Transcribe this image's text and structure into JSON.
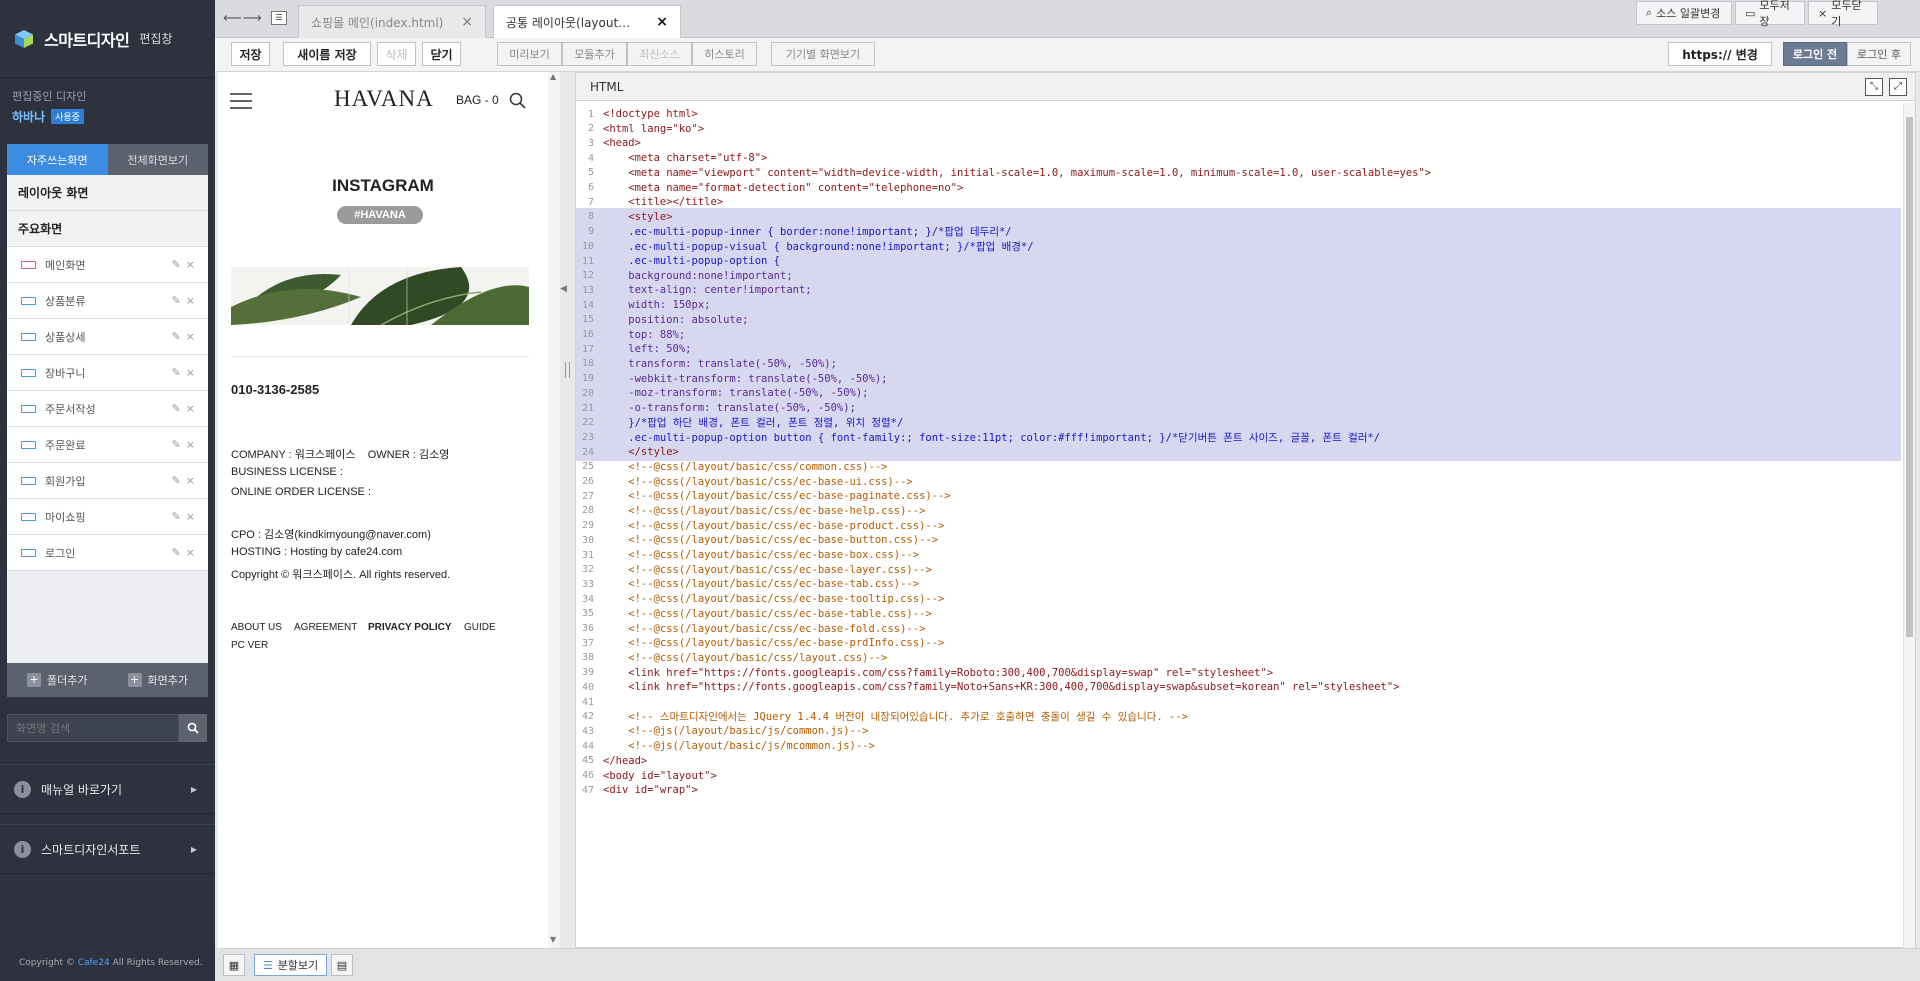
{
  "sidebar": {
    "brand": "스마트디자인",
    "brand_sub": "편집창",
    "editing_label": "편집중인 디자인",
    "design_name": "하바나",
    "design_badge": "사용중",
    "tab_active": "자주쓰는화면",
    "tab_other": "전체화면보기",
    "section_layout": "레이아웃 화면",
    "section_main": "주요화면",
    "items": [
      {
        "label": "메인화면",
        "icon": "page-icon-pink"
      },
      {
        "label": "상품분류",
        "icon": "page-icon"
      },
      {
        "label": "상품상세",
        "icon": "page-icon"
      },
      {
        "label": "장바구니",
        "icon": "page-icon"
      },
      {
        "label": "주문서작성",
        "icon": "page-icon"
      },
      {
        "label": "주문완료",
        "icon": "page-icon"
      },
      {
        "label": "회원가입",
        "icon": "page-icon"
      },
      {
        "label": "마이쇼핑",
        "icon": "page-icon"
      },
      {
        "label": "로그인",
        "icon": "page-icon"
      }
    ],
    "add_folder": "폴더추가",
    "add_screen": "화면추가",
    "search_placeholder": "화면명 검색",
    "manual_link": "매뉴얼 바로가기",
    "support_link": "스마트디자인서포트",
    "copyright_pre": "Copyright ©",
    "copyright_brand": "Cafe24",
    "copyright_post": "All Rights Reserved."
  },
  "tabs": {
    "tab1": "쇼핑몰 메인(index.html)",
    "tab2": "공통 레이아웃(layout…",
    "btn_source": "소스 일괄변경",
    "btn_saveall": "모두저장",
    "btn_closeall": "모두닫기"
  },
  "toolbar": {
    "save": "저장",
    "save_as": "새이름 저장",
    "delete": "삭제",
    "close": "닫기",
    "preview": "미리보기",
    "add_module": "모듈추가",
    "latest_source": "최신소스",
    "history": "히스토리",
    "device_view": "기기별 화면보기",
    "https": "https:// 변경",
    "before_login": "로그인 전",
    "after_login": "로그인 후"
  },
  "preview": {
    "logo": "HAVANA",
    "bag": "BAG - 0",
    "instagram": "INSTAGRAM",
    "hashtag": "#HAVANA",
    "phone": "010-3136-2585",
    "company": "COMPANY : 워크스페이스    OWNER : 김소영",
    "business": "BUSINESS LICENSE :",
    "online": "ONLINE ORDER LICENSE :",
    "cpo": "CPO : 김소영(kindkimyoung@naver.com)",
    "hosting": "HOSTING : Hosting by cafe24.com",
    "copyright": "Copyright © 워크스페이스. All rights reserved.",
    "links": [
      "ABOUT US",
      "AGREEMENT",
      "PRIVACY POLICY",
      "GUIDE"
    ],
    "pc_ver": "PC VER"
  },
  "editor": {
    "title": "HTML",
    "lines": [
      "<!doctype html>",
      "<html lang=\"ko\">",
      "<head>",
      "    <meta charset=\"utf-8\">",
      "    <meta name=\"viewport\" content=\"width=device-width, initial-scale=1.0, maximum-scale=1.0, minimum-scale=1.0, user-scalable=yes\">",
      "    <meta name=\"format-detection\" content=\"telephone=no\">",
      "    <title></title>",
      "    <style>",
      "    .ec-multi-popup-inner { border:none!important; }/*팝업 테두리*/",
      "    .ec-multi-popup-visual { background:none!important; }/*팝업 배경*/",
      "    .ec-multi-popup-option {",
      "    background:none!important;",
      "    text-align: center!important;",
      "    width: 150px;",
      "    position: absolute;",
      "    top: 88%;",
      "    left: 50%;",
      "    transform: translate(-50%, -50%);",
      "    -webkit-transform: translate(-50%, -50%);",
      "    -moz-transform: translate(-50%, -50%);",
      "    -o-transform: translate(-50%, -50%);",
      "    }/*팝업 하단 배경, 폰트 컬러, 폰트 정렬, 위치 정렬*/",
      "    .ec-multi-popup-option button { font-family:; font-size:11pt; color:#fff!important; }/*닫기버튼 폰트 사이즈, 글꼴, 폰트 컬러*/",
      "    </style>",
      "    <!--@css(/layout/basic/css/common.css)-->",
      "    <!--@css(/layout/basic/css/ec-base-ui.css)-->",
      "    <!--@css(/layout/basic/css/ec-base-paginate.css)-->",
      "    <!--@css(/layout/basic/css/ec-base-help.css)-->",
      "    <!--@css(/layout/basic/css/ec-base-product.css)-->",
      "    <!--@css(/layout/basic/css/ec-base-button.css)-->",
      "    <!--@css(/layout/basic/css/ec-base-box.css)-->",
      "    <!--@css(/layout/basic/css/ec-base-layer.css)-->",
      "    <!--@css(/layout/basic/css/ec-base-tab.css)-->",
      "    <!--@css(/layout/basic/css/ec-base-tooltip.css)-->",
      "    <!--@css(/layout/basic/css/ec-base-table.css)-->",
      "    <!--@css(/layout/basic/css/ec-base-fold.css)-->",
      "    <!--@css(/layout/basic/css/ec-base-prdInfo.css)-->",
      "    <!--@css(/layout/basic/css/layout.css)-->",
      "    <link href=\"https://fonts.googleapis.com/css?family=Roboto:300,400,700&display=swap\" rel=\"stylesheet\">",
      "    <link href=\"https://fonts.googleapis.com/css?family=Noto+Sans+KR:300,400,700&display=swap&subset=korean\" rel=\"stylesheet\">",
      "",
      "    <!-- 스마트디자인에서는 JQuery 1.4.4 버전이 내장되어있습니다. 추가로 호출하면 충돌이 생길 수 있습니다. -->",
      "    <!--@js(/layout/basic/js/common.js)-->",
      "    <!--@js(/layout/basic/js/mcommon.js)-->",
      "</head>",
      "<body id=\"layout\">",
      "<div id=\"wrap\">"
    ]
  },
  "bottom": {
    "split_view": "분할보기"
  },
  "colors": {
    "sidebar_bg": "#2d323e",
    "accent": "#3b8be0",
    "selection": "#d7d7f0"
  }
}
